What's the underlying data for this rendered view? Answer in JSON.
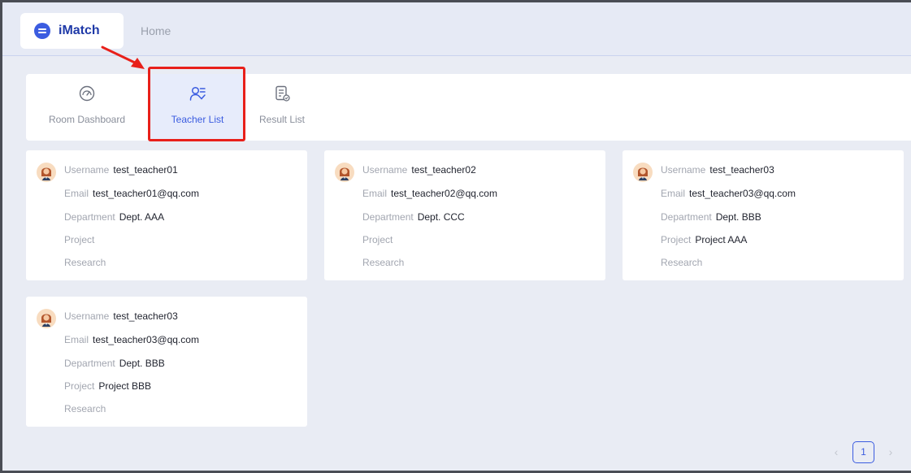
{
  "header": {
    "app_name": "iMatch",
    "home_link": "Home"
  },
  "tabs": [
    {
      "label": "Room Dashboard",
      "icon": "speedometer-icon",
      "active": false
    },
    {
      "label": "Teacher List",
      "icon": "user-list-icon",
      "active": true
    },
    {
      "label": "Result List",
      "icon": "result-document-icon",
      "active": false
    }
  ],
  "teachers": [
    {
      "username_label": "Username",
      "username": "test_teacher01",
      "email_label": "Email",
      "email": "test_teacher01@qq.com",
      "department_label": "Department",
      "department": "Dept. AAA",
      "project_label": "Project",
      "project": "",
      "research_label": "Research",
      "research": ""
    },
    {
      "username_label": "Username",
      "username": "test_teacher02",
      "email_label": "Email",
      "email": "test_teacher02@qq.com",
      "department_label": "Department",
      "department": "Dept. CCC",
      "project_label": "Project",
      "project": "",
      "research_label": "Research",
      "research": ""
    },
    {
      "username_label": "Username",
      "username": "test_teacher03",
      "email_label": "Email",
      "email": "test_teacher03@qq.com",
      "department_label": "Department",
      "department": "Dept. BBB",
      "project_label": "Project",
      "project": "Project AAA",
      "research_label": "Research",
      "research": ""
    },
    {
      "username_label": "Username",
      "username": "test_teacher03",
      "email_label": "Email",
      "email": "test_teacher03@qq.com",
      "department_label": "Department",
      "department": "Dept. BBB",
      "project_label": "Project",
      "project": "Project BBB",
      "research_label": "Research",
      "research": ""
    }
  ],
  "pagination": {
    "prev_icon": "chevron-left-icon",
    "current_page": "1",
    "next_icon": "chevron-right-icon"
  },
  "colors": {
    "accent": "#3b5ce0",
    "annotation": "#e8201a",
    "background": "#e9ecf4"
  }
}
